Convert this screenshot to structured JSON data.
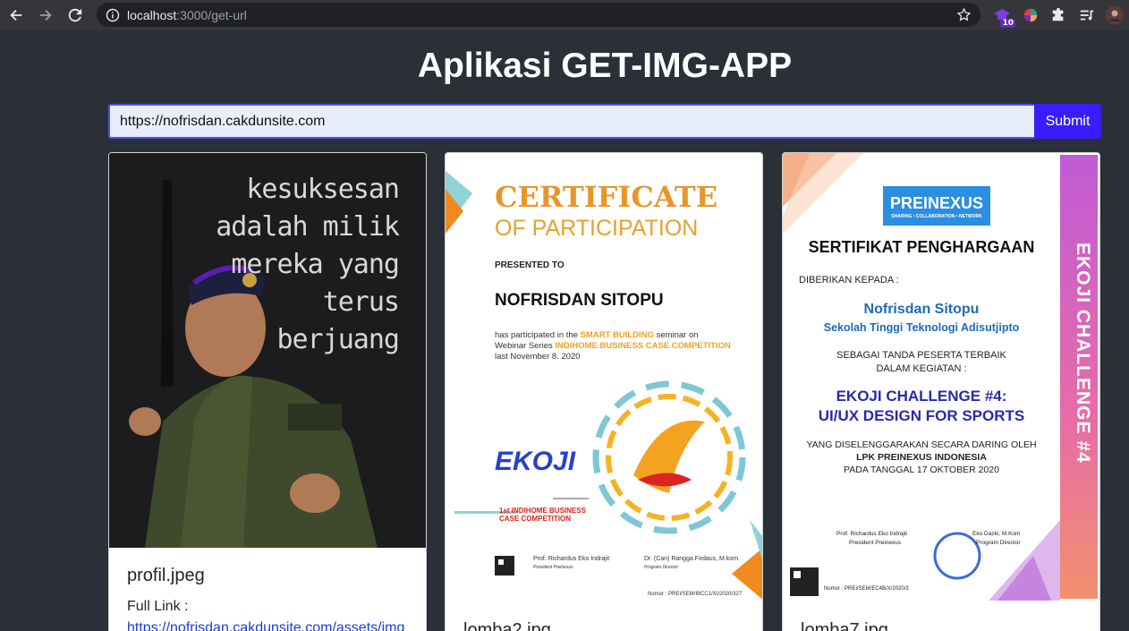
{
  "browser": {
    "url_host": "localhost",
    "url_path": ":3000/get-url",
    "extension_badge": "10"
  },
  "page": {
    "title": "Aplikasi GET-IMG-APP",
    "input_value": "https://nofrisdan.cakdunsite.com",
    "submit_label": "Submit"
  },
  "cards": [
    {
      "name": "profil.jpeg",
      "link_label": "Full Link :",
      "link": "https://nofrisdan.cakdunsite.com/assets/img",
      "image_quote": [
        "kesuksesan",
        "adalah milik",
        "mereka yang",
        "terus",
        "berjuang"
      ]
    },
    {
      "name": "lomba2.jpg",
      "cert_title": "CERTIFICATE",
      "cert_sub": "OF PARTICIPATION",
      "presented": "PRESENTED TO",
      "recipient": "NOFRISDAN SITOPU",
      "body_1": "has participated in the",
      "body_highlight_1": "SMART BUILDING",
      "body_2": "seminar on",
      "body_3": "Webinar Series",
      "body_highlight_2": "INDIHOME BUSINESS CASE COMPETITION",
      "body_4": "last November 8. 2020",
      "brand": "EKOJI",
      "badge_text": "1st INDIHOME BUSINESS CASE COMPETITION",
      "sig1": "Prof. Richardus Eko Indrajit",
      "sig1_role": "President Preinexus",
      "sig2": "Dr. (Can) Rangga Firdaus, M.kom.",
      "sig2_role": "Program Director",
      "nomor": "Nomor : PREI/SEM/IBCC1/XI/2020/327"
    },
    {
      "name": "lomba7.jpg",
      "logo": "PREINEXUS",
      "logo_tag": "SHARING • COLLABORATION • NETWORK",
      "heading": "SERTIFIKAT PENGHARGAAN",
      "given_to": "DIBERIKAN KEPADA :",
      "recipient": "Nofrisdan Sitopu",
      "school": "Sekolah Tinggi Teknologi Adisutjipto",
      "as_line1": "SEBAGAI TANDA PESERTA TERBAIK",
      "as_line2": "DALAM KEGIATAN :",
      "event_1": "EKOJI CHALLENGE #4:",
      "event_2": "UI/UX DESIGN FOR SPORTS",
      "held_1": "YANG DISELENGGARAKAN SECARA DARING OLEH",
      "held_2": "LPK PREINEXUS INDONESIA",
      "held_3": "PADA TANGGAL 17 OKTOBER 2020",
      "side_band": "EKOJI CHALLENGE #4",
      "sig1": "Prof. Richardus Eko Indrajit",
      "sig1_role": "President Preinexus",
      "sig2": "Eko Dazki, M.Kom",
      "sig2_role": "Program Director",
      "nomor": "Nomor : PREI/SEM/EC4B/X/2020/3"
    }
  ]
}
